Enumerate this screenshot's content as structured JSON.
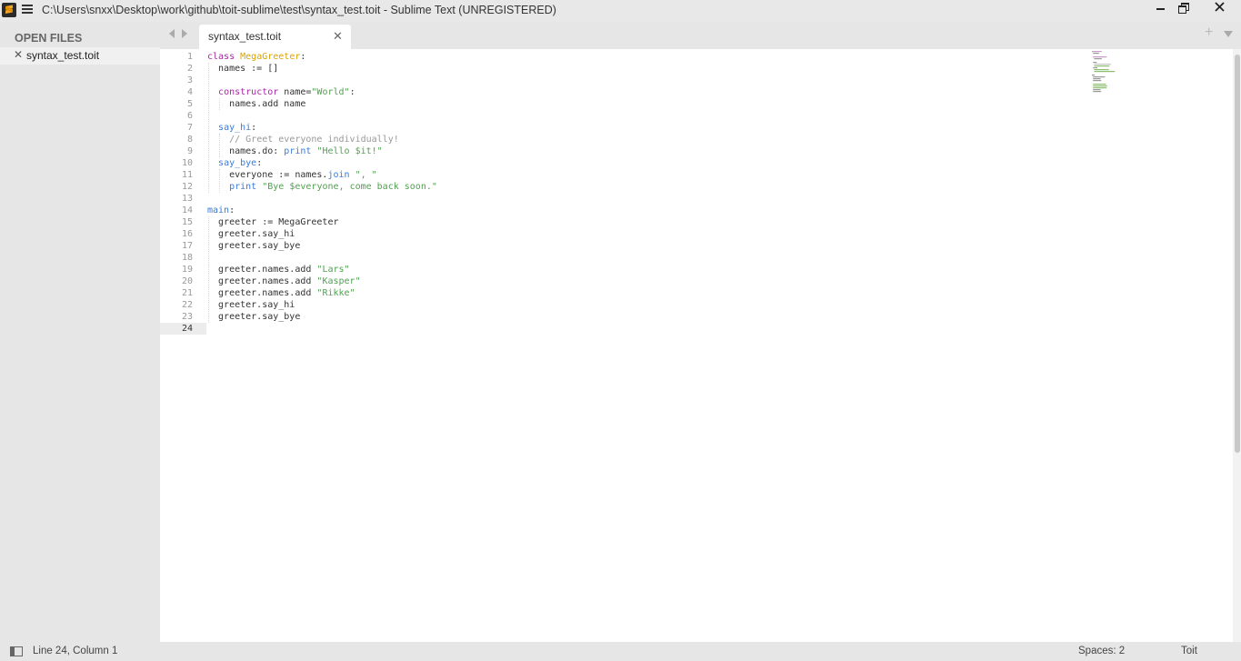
{
  "window": {
    "title": "C:\\Users\\snxx\\Desktop\\work\\github\\toit-sublime\\test\\syntax_test.toit - Sublime Text (UNREGISTERED)"
  },
  "sidebar": {
    "heading": "OPEN FILES",
    "files": [
      {
        "name": "syntax_test.toit",
        "close": "✕"
      }
    ]
  },
  "tabs": [
    {
      "label": "syntax_test.toit",
      "close": "✕",
      "active": true
    }
  ],
  "tabbar": {
    "new_tab": "+"
  },
  "editor": {
    "current_line": 24,
    "line_numbers": [
      "1",
      "2",
      "3",
      "4",
      "5",
      "6",
      "7",
      "8",
      "9",
      "10",
      "11",
      "12",
      "13",
      "14",
      "15",
      "16",
      "17",
      "18",
      "19",
      "20",
      "21",
      "22",
      "23",
      "24"
    ],
    "lines": [
      "class MegaGreeter:",
      "  names := []",
      "",
      "  constructor name=\"World\":",
      "    names.add name",
      "",
      "  say_hi:",
      "    // Greet everyone individually!",
      "    names.do: print \"Hello $it!\"",
      "  say_bye:",
      "    everyone := names.join \", \"",
      "    print \"Bye $everyone, come back soon.\"",
      "",
      "main:",
      "  greeter := MegaGreeter",
      "  greeter.say_hi",
      "  greeter.say_bye",
      "",
      "  greeter.names.add \"Lars\"",
      "  greeter.names.add \"Kasper\"",
      "  greeter.names.add \"Rikke\"",
      "  greeter.say_hi",
      "  greeter.say_bye",
      ""
    ]
  },
  "statusbar": {
    "position": "Line 24, Column 1",
    "indentation": "Spaces: 2",
    "syntax": "Toit"
  },
  "colors": {
    "keyword": "#a626a4",
    "class_name": "#d9a400",
    "function": "#3a7bd5",
    "string": "#50a14f",
    "comment": "#999999"
  }
}
